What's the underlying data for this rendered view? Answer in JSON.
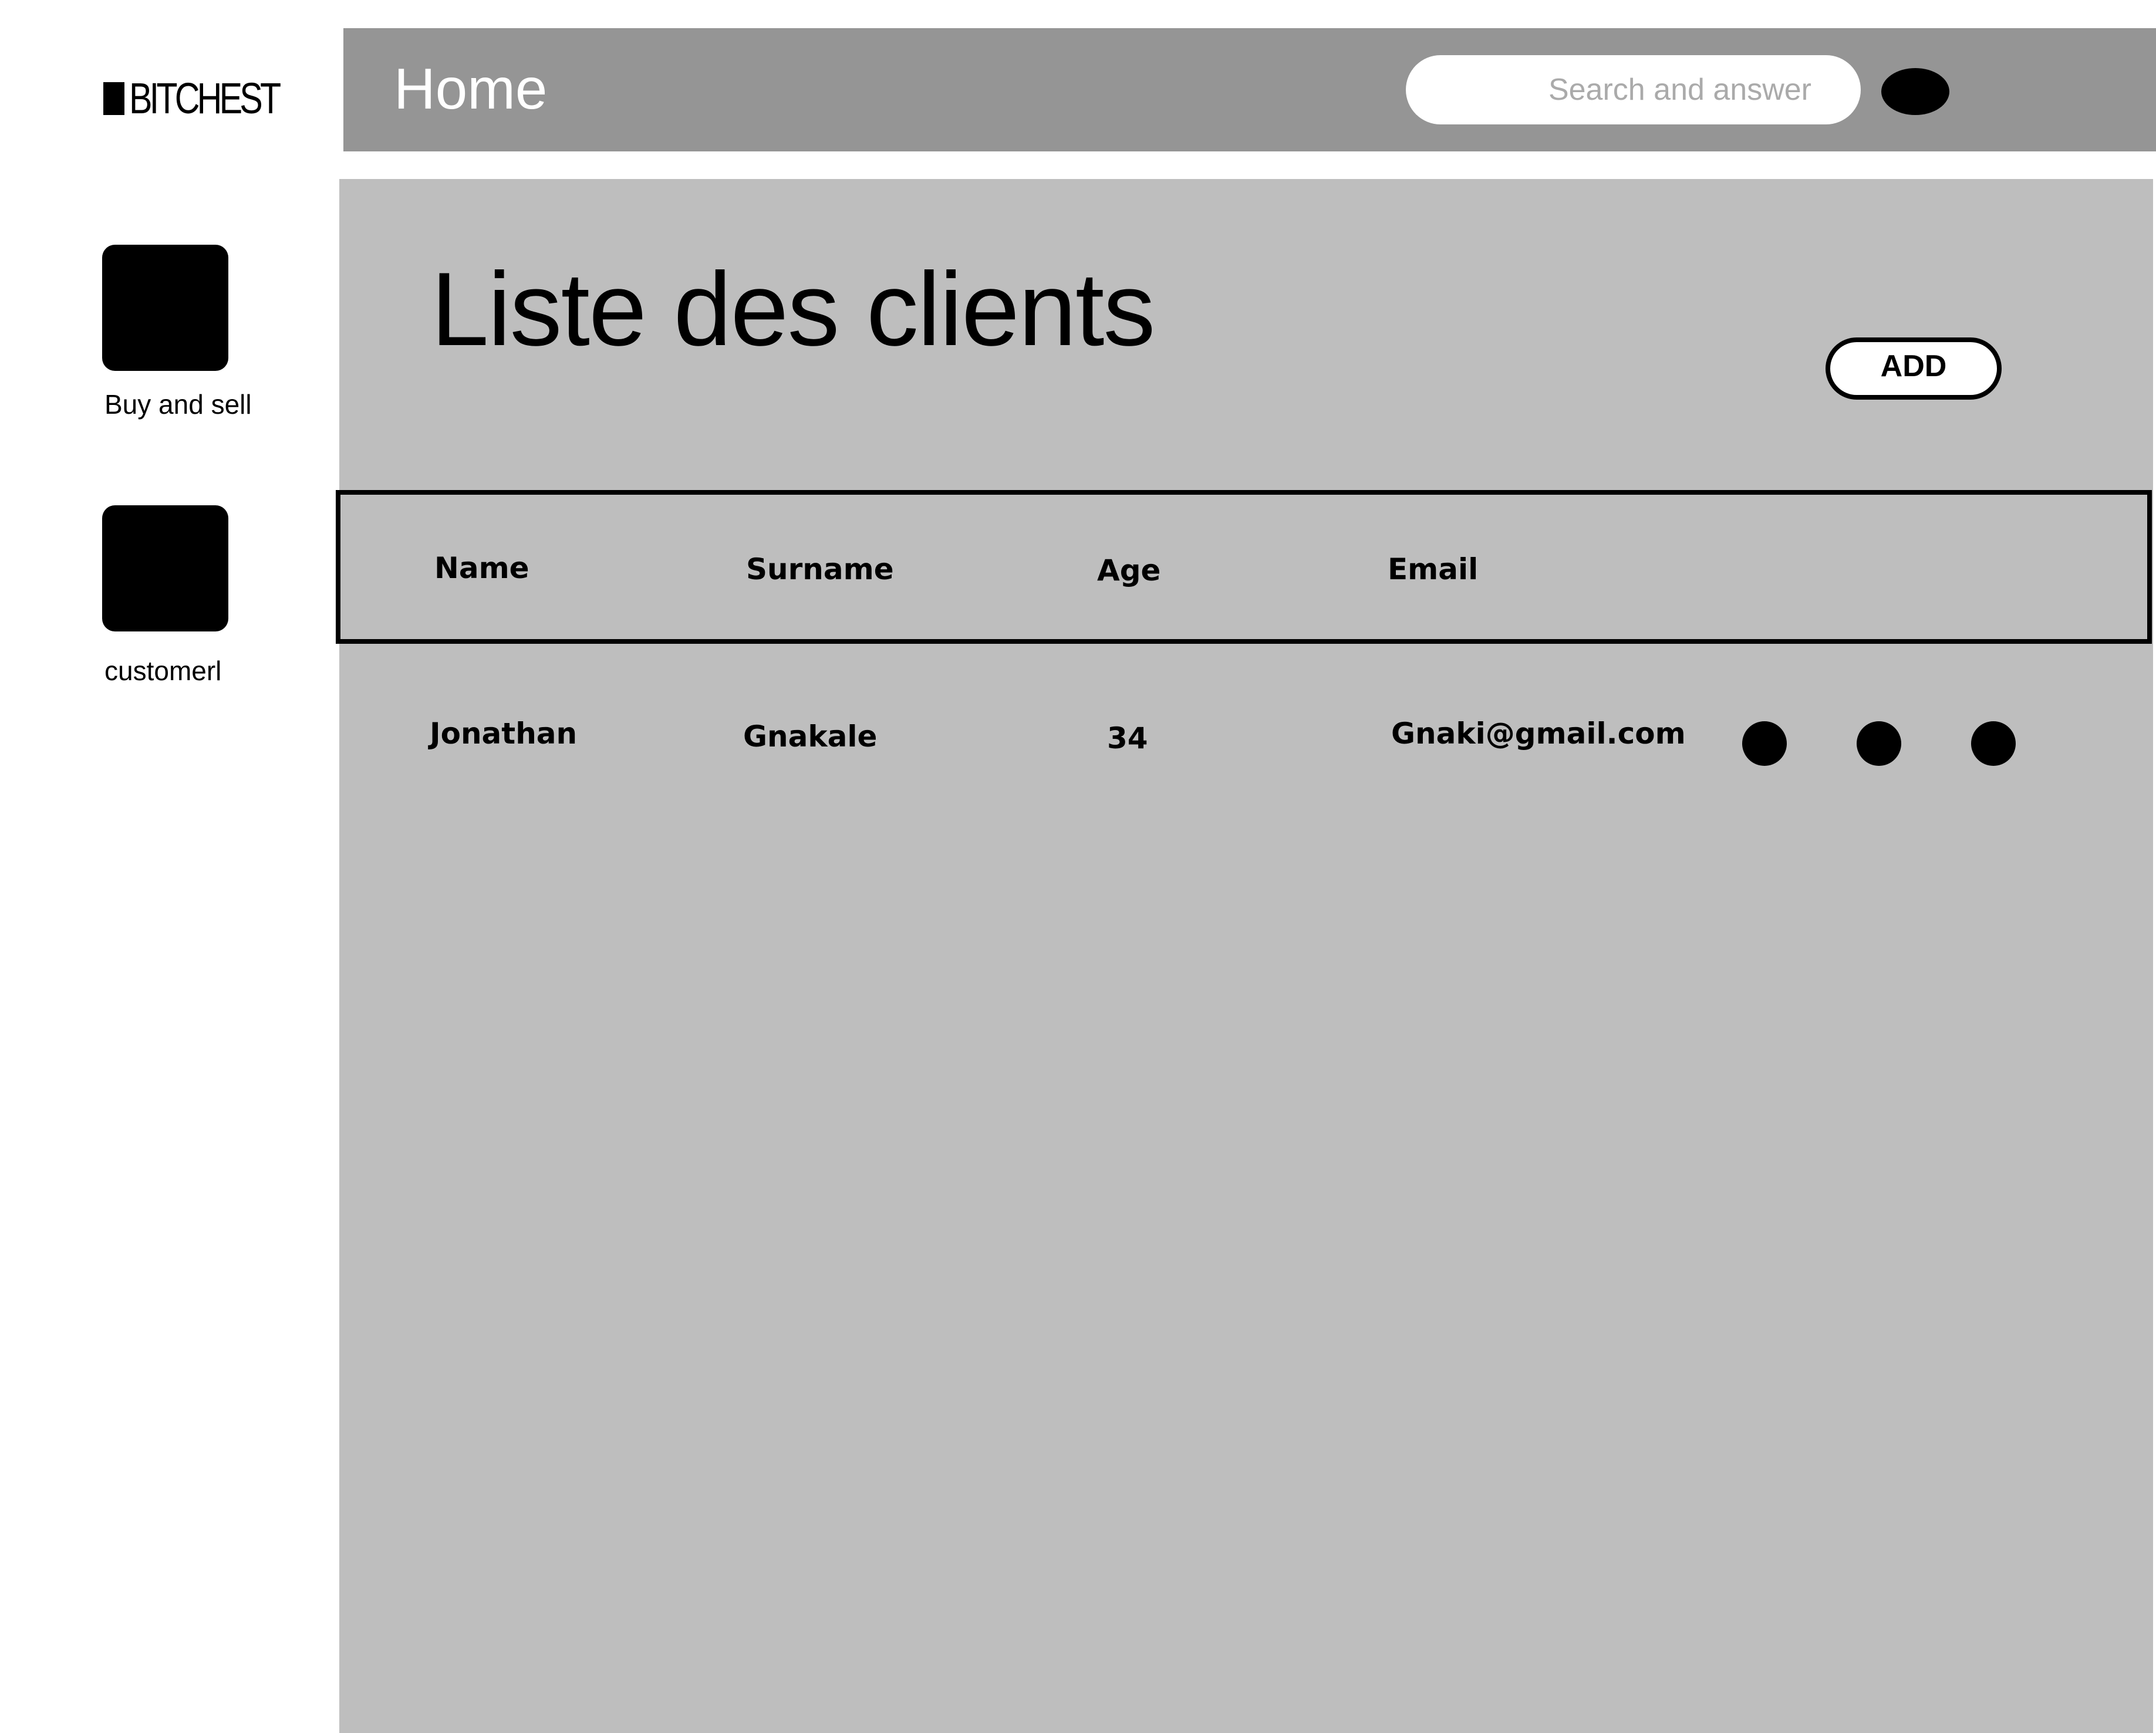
{
  "sidebar": {
    "logo_text": "BITCHEST",
    "items": [
      {
        "label": "Buy and sell",
        "icon": "buy-sell-icon"
      },
      {
        "label": "customerl",
        "icon": "customer-icon"
      }
    ]
  },
  "header": {
    "title": "Home",
    "search_placeholder": "Search and answer",
    "avatar_icon": "avatar-icon"
  },
  "main": {
    "page_title": "Liste des clients",
    "add_label": "ADD",
    "table": {
      "columns": [
        "Name",
        "Surname",
        "Age",
        "Email"
      ],
      "rows": [
        {
          "name": "Jonathan",
          "surname": "Gnakale",
          "age": "34",
          "email": "Gnaki@gmail.com",
          "actions": [
            "action-dot-1-icon",
            "action-dot-2-icon",
            "action-dot-3-icon"
          ]
        }
      ]
    }
  },
  "colors": {
    "header_bg": "#959595",
    "panel_bg": "#bebebe",
    "page_bg": "#ffffff",
    "accent": "#000000"
  }
}
